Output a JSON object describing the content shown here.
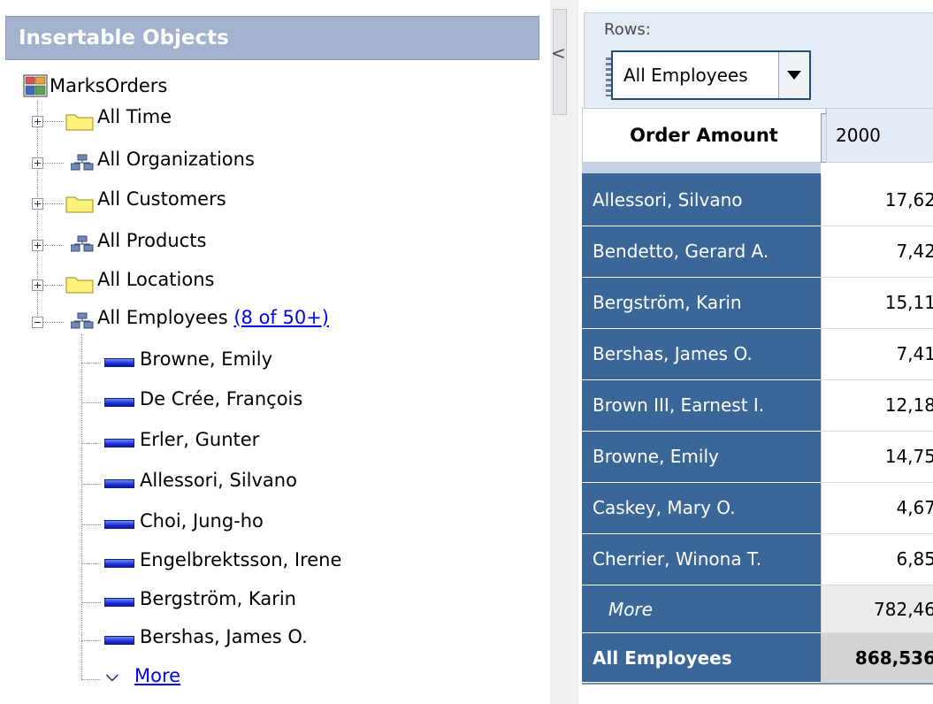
{
  "panel": {
    "title": "Insertable Objects",
    "root": "MarksOrders",
    "collapse_arrow": "<",
    "nodes": [
      {
        "label": "All Time",
        "icon": "folder-icon",
        "expanded": false
      },
      {
        "label": "All Organizations",
        "icon": "hierarchy-icon",
        "expanded": false
      },
      {
        "label": "All Customers",
        "icon": "folder-icon",
        "expanded": false
      },
      {
        "label": "All Products",
        "icon": "hierarchy-icon",
        "expanded": false
      },
      {
        "label": "All Locations",
        "icon": "folder-icon",
        "expanded": false
      },
      {
        "label": "All Employees",
        "icon": "hierarchy-icon",
        "expanded": true,
        "count": "(8 of 50+)"
      }
    ],
    "members": [
      "Browne, Emily",
      "De Crée, François",
      "Erler, Gunter",
      "Allessori, Silvano",
      "Choi, Jung-ho",
      "Engelbrektsson, Irene",
      "Bergström, Karin",
      "Bershas, James O."
    ],
    "more_label": "More"
  },
  "rows": {
    "label": "Rows:",
    "value": "All Employees"
  },
  "grid": {
    "measure_header": "Order Amount",
    "column_header": "2000",
    "rows": [
      {
        "name": "Allessori, Silvano",
        "value": "17,62"
      },
      {
        "name": "Bendetto, Gerard A.",
        "value": "7,42"
      },
      {
        "name": "Bergström, Karin",
        "value": "15,11"
      },
      {
        "name": "Bershas, James O.",
        "value": "7,41"
      },
      {
        "name": "Brown III, Earnest I.",
        "value": "12,18"
      },
      {
        "name": "Browne, Emily",
        "value": "14,75"
      },
      {
        "name": "Caskey, Mary O.",
        "value": "4,67"
      },
      {
        "name": "Cherrier, Winona T.",
        "value": "6,85"
      }
    ],
    "more": {
      "name": "More",
      "value": "782,46"
    },
    "total": {
      "name": "All Employees",
      "value": "868,536"
    }
  }
}
